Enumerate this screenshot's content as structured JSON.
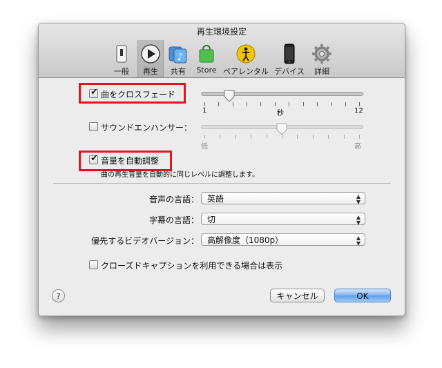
{
  "window": {
    "title": "再生環境設定"
  },
  "toolbar": {
    "items": [
      {
        "label": "一般",
        "icon": "general-switch-icon"
      },
      {
        "label": "再生",
        "icon": "play-icon"
      },
      {
        "label": "共有",
        "icon": "shared-music-icon"
      },
      {
        "label": "Store",
        "icon": "shopping-bag-icon"
      },
      {
        "label": "ペアレンタル",
        "icon": "parental-icon"
      },
      {
        "label": "デバイス",
        "icon": "iphone-device-icon"
      },
      {
        "label": "詳細",
        "icon": "gear-icon"
      }
    ],
    "selected": "再生"
  },
  "crossfade": {
    "label": "曲をクロスフェード",
    "checked": true,
    "min_label": "1",
    "mid_label": "秒",
    "max_label": "12",
    "value": 3
  },
  "sound_enhancer": {
    "label": "サウンドエンハンサー：",
    "checked": false,
    "min_label": "低",
    "max_label": "高",
    "value": 0.5
  },
  "sound_check": {
    "label": "音量を自動調整",
    "checked": true,
    "description": "曲の再生音量を自動的に同じレベルに調整します。"
  },
  "audio_language": {
    "label": "音声の言語：",
    "value": "英語"
  },
  "subtitle_language": {
    "label": "字幕の言語：",
    "value": "切"
  },
  "preferred_video": {
    "label": "優先するビデオバージョン：",
    "value": "高解像度（1080p）"
  },
  "closed_caption": {
    "label": "クローズドキャプションを利用できる場合は表示",
    "checked": false
  },
  "buttons": {
    "help": "?",
    "cancel": "キャンセル",
    "ok": "OK"
  },
  "colors": {
    "highlight_box": "#e0141e",
    "default_button": "#6aa6ea"
  }
}
